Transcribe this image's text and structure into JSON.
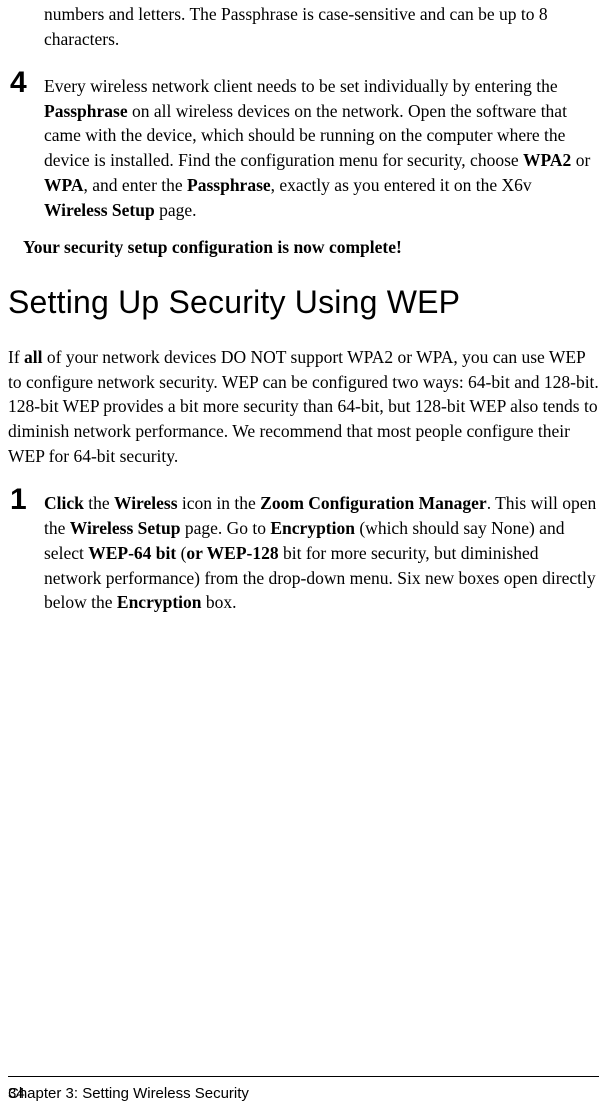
{
  "continuation": "numbers and letters. The Passphrase is case-sensitive and can be up to 8 characters.",
  "step4": {
    "num": "4",
    "t1": "Every wireless network client needs to be set individually by entering the ",
    "t2": "Passphrase",
    "t3": " on all wireless devices on the network. Open the software that came with the device, which should be running on the computer where the device is installed. Find the configuration menu for security, choose ",
    "t4": "WPA2",
    "t5": " or ",
    "t6": "WPA",
    "t7": ", and enter the ",
    "t8": "Passphrase",
    "t9": ", exactly as you entered it on the X6v ",
    "t10": "Wireless Setup",
    "t11": " page."
  },
  "completion_text": "Your security setup configuration is now complete!",
  "heading": "Setting Up Security Using WEP",
  "intro": {
    "t1": "If ",
    "t2": "all",
    "t3": " of your network devices DO NOT support WPA2 or WPA, you can use WEP to configure network security. WEP can be configured two ways: 64-bit and 128-bit. 128-bit WEP provides a bit more security than 64-bit, but 128-bit WEP also tends to diminish network performance. We recommend that most people configure their WEP for 64-bit security."
  },
  "step1": {
    "num": "1",
    "t1": "Click",
    "t2": " the ",
    "t3": "Wireless",
    "t4": " icon in the ",
    "t5": "Zoom Configuration Manager",
    "t6": ". This will open the ",
    "t7": "Wireless Setup",
    "t8": " page. Go to ",
    "t9": "Encryption",
    "t10": " (which should say None) and select ",
    "t11": "WEP-64 bit",
    "t12": " (",
    "t13": "or WEP-128",
    "t14": " bit for more security, but diminished network performance) from the drop-down menu. Six new boxes open directly below the ",
    "t15": "Encryption",
    "t16": " box."
  },
  "footer_text": "Chapter 3: Setting Wireless Security",
  "page_num": "34"
}
